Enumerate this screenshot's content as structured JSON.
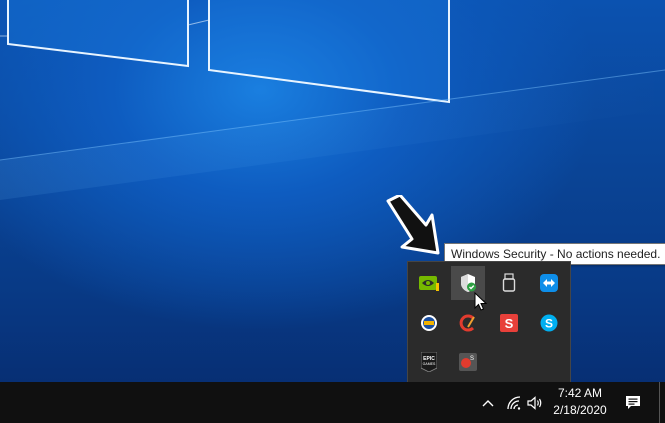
{
  "tooltip": {
    "text": "Windows Security - No actions needed."
  },
  "tray_flyout": {
    "icons": [
      {
        "name": "nvidia-icon",
        "label": "NVIDIA"
      },
      {
        "name": "windows-security-icon",
        "label": "Windows Security",
        "hovered": true
      },
      {
        "name": "usb-drive-icon",
        "label": "USB"
      },
      {
        "name": "teamviewer-icon",
        "label": "TeamViewer"
      },
      {
        "name": "media-app-icon",
        "label": "Media app"
      },
      {
        "name": "ccleaner-icon",
        "label": "CCleaner"
      },
      {
        "name": "sumatra-pdf-icon",
        "label": "S"
      },
      {
        "name": "skype-icon",
        "label": "S"
      },
      {
        "name": "epic-games-icon",
        "label": "EPIC GAMES"
      },
      {
        "name": "steelseries-icon",
        "label": "S"
      }
    ]
  },
  "taskbar": {
    "clock": {
      "time": "7:42 AM",
      "date": "2/18/2020"
    },
    "icons": [
      "chevron-up-icon",
      "wifi-icon",
      "volume-icon",
      "action-center-icon"
    ]
  },
  "colors": {
    "desktop_blue": "#0a4496",
    "taskbar": "#101010",
    "flyout": "#2b2b2b",
    "security_green": "#2ea043"
  }
}
